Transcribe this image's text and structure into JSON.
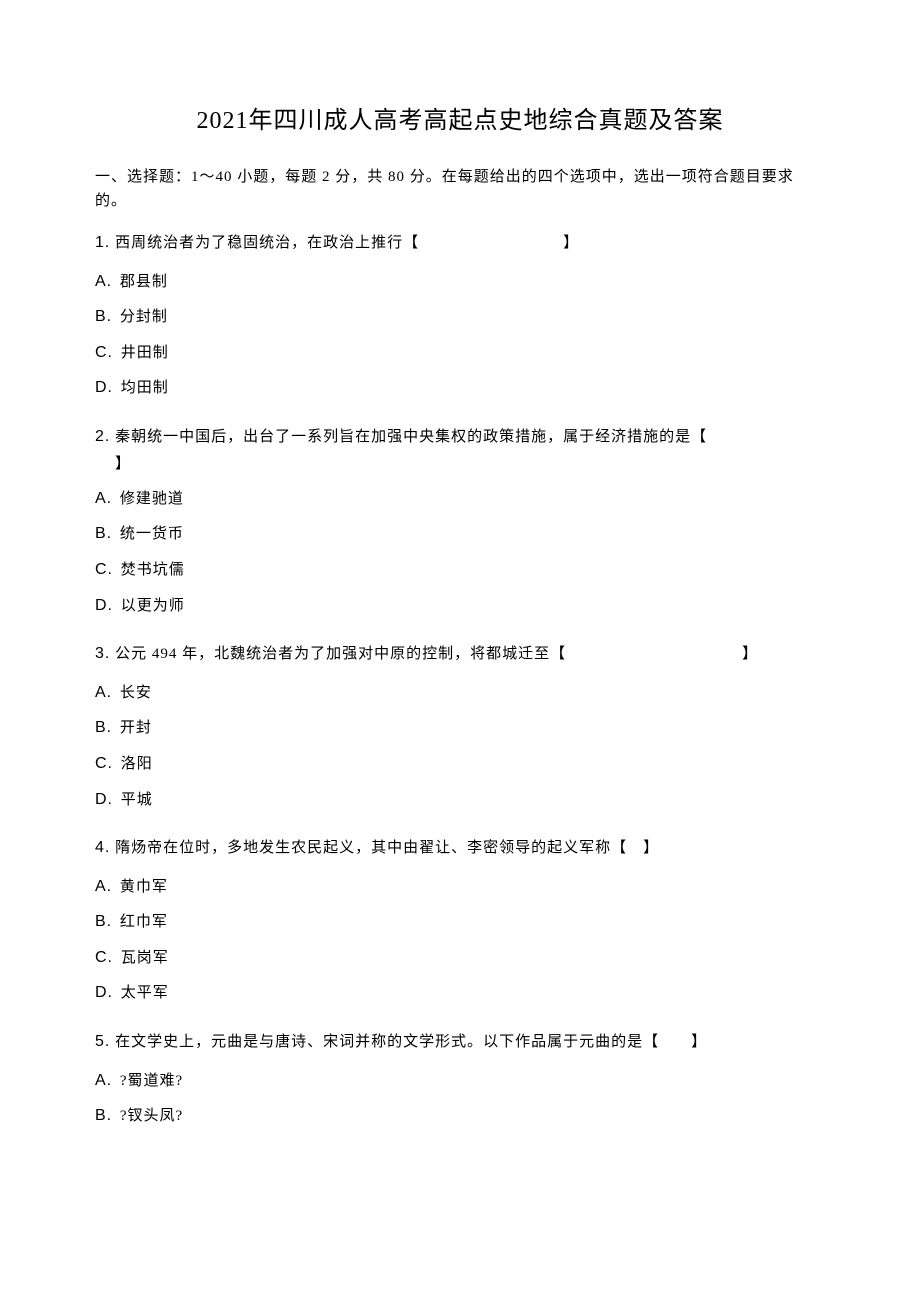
{
  "title": "2021年四川成人高考高起点史地综合真题及答案",
  "instructions": "一、选择题：1～40 小题，每题 2 分，共 80 分。在每题给出的四个选项中，选出一项符合题目要求的。",
  "questions": [
    {
      "number": "1.",
      "text": "西周统治者为了稳固统治，在政治上推行【",
      "bracket_space": "　　　　　　　　　",
      "bracket_end": "】",
      "options": [
        {
          "letter": "A.",
          "text": "郡县制"
        },
        {
          "letter": "B.",
          "text": "分封制"
        },
        {
          "letter": "C.",
          "text": "井田制"
        },
        {
          "letter": "D.",
          "text": "均田制"
        }
      ]
    },
    {
      "number": "2.",
      "text": "秦朝统一中国后，出台了一系列旨在加强中央集权的政策措施，属于经济措施的是【",
      "continuation": "】",
      "options": [
        {
          "letter": "A.",
          "text": "修建驰道"
        },
        {
          "letter": "B.",
          "text": "统一货币"
        },
        {
          "letter": "C.",
          "text": "焚书坑儒"
        },
        {
          "letter": "D.",
          "text": "以更为师"
        }
      ]
    },
    {
      "number": "3.",
      "text": "公元 494 年，北魏统治者为了加强对中原的控制，将都城迁至【",
      "bracket_space": "　　　　　　　　　　　",
      "bracket_end": "】",
      "options": [
        {
          "letter": "A.",
          "text": "长安"
        },
        {
          "letter": "B.",
          "text": "开封"
        },
        {
          "letter": "C.",
          "text": "洛阳"
        },
        {
          "letter": "D.",
          "text": "平城"
        }
      ]
    },
    {
      "number": "4.",
      "text": "隋炀帝在位时，多地发生农民起义，其中由翟让、李密领导的起义军称【　】",
      "options": [
        {
          "letter": "A.",
          "text": "黄巾军"
        },
        {
          "letter": "B.",
          "text": "红巾军"
        },
        {
          "letter": "C.",
          "text": "瓦岗军"
        },
        {
          "letter": "D.",
          "text": "太平军"
        }
      ]
    },
    {
      "number": "5.",
      "text": "在文学史上，元曲是与唐诗、宋词并称的文学形式。以下作品属于元曲的是【　　】",
      "options": [
        {
          "letter": "A.",
          "text": "?蜀道难?"
        },
        {
          "letter": "B.",
          "text": "?钗头凤?"
        }
      ]
    }
  ]
}
